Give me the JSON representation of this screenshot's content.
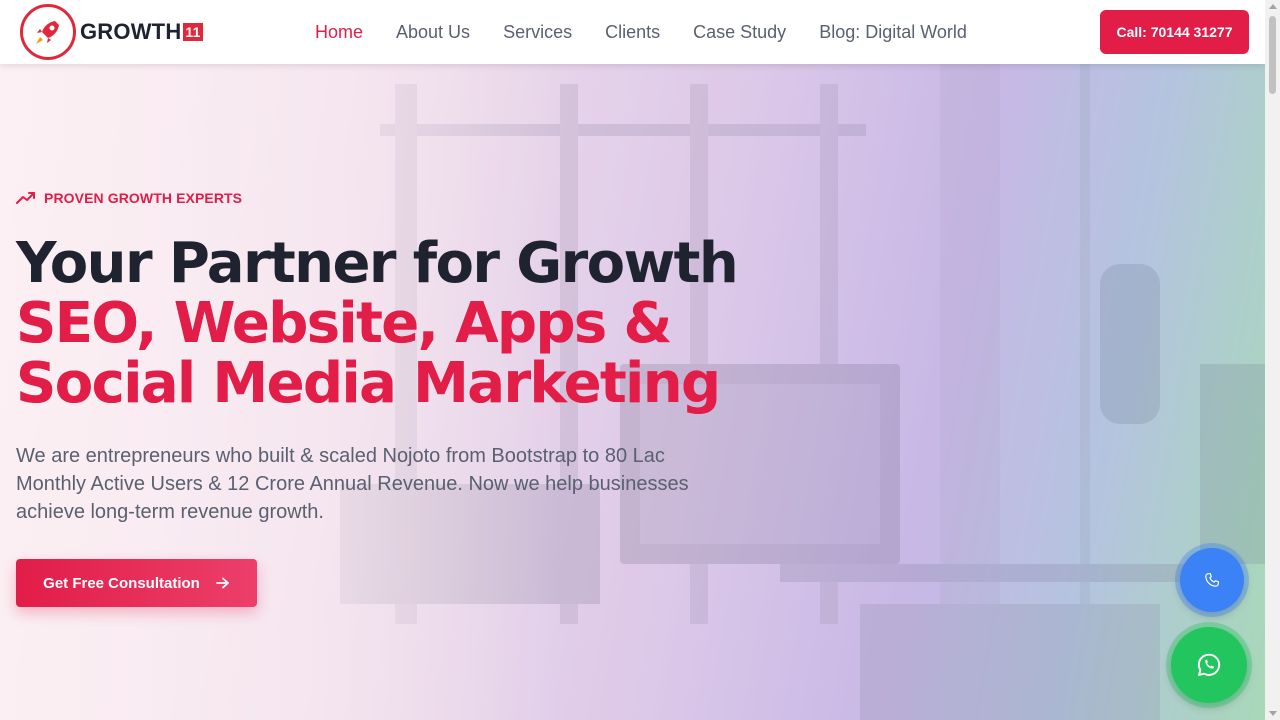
{
  "header": {
    "logo_text": "GROWTH",
    "logo_number": "11",
    "nav": [
      {
        "label": "Home",
        "active": true
      },
      {
        "label": "About Us"
      },
      {
        "label": "Services"
      },
      {
        "label": "Clients"
      },
      {
        "label": "Case Study"
      },
      {
        "label": "Blog: Digital World"
      }
    ],
    "call_button": "Call: 70144 31277"
  },
  "hero": {
    "eyebrow": "PROVEN GROWTH EXPERTS",
    "title_line1": "Your Partner for Growth",
    "title_line2": "SEO, Website, Apps &",
    "title_line3": "Social Media Marketing",
    "description": "We are entrepreneurs who built & scaled Nojoto from Bootstrap to 80 Lac Monthly Active Users & 12 Crore Annual Revenue. Now we help businesses achieve long-term revenue growth.",
    "cta_label": "Get Free Consultation"
  },
  "floating": {
    "phone_icon": "phone-icon",
    "whatsapp_icon": "whatsapp-icon"
  },
  "colors": {
    "brand": "#e11d48",
    "text_dark": "#1f2330",
    "text_muted": "#5a6070",
    "phone_fab": "#3b82f6",
    "whatsapp_fab": "#22c55e"
  }
}
